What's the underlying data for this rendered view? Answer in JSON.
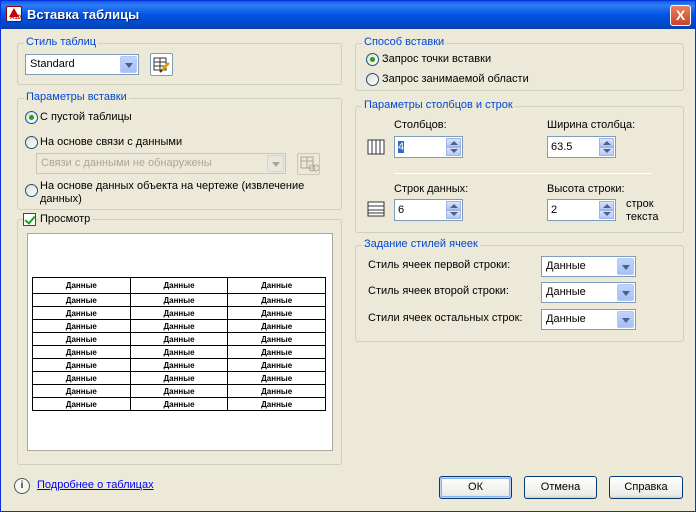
{
  "window": {
    "title": "Вставка таблицы",
    "close_label": "X",
    "app_icon_text": "A10"
  },
  "table_style": {
    "legend": "Стиль таблиц",
    "selected": "Standard",
    "edit_icon": "table-style-dialog-icon"
  },
  "insert_params": {
    "legend": "Параметры вставки",
    "options": [
      {
        "label": "С пустой таблицы",
        "checked": true
      },
      {
        "label": "На основе связи с данными",
        "checked": false
      },
      {
        "label": "На основе данных объекта на чертеже (извлечение данных)",
        "checked": false
      }
    ],
    "data_link_placeholder": "Связи с данными не обнаружены",
    "data_link_icon": "data-link-manager-icon"
  },
  "preview": {
    "label": "Просмотр",
    "checked": true,
    "header": [
      "Данные",
      "Данные",
      "Данные"
    ],
    "rows": [
      [
        "Данные",
        "Данные",
        "Данные"
      ],
      [
        "Данные",
        "Данные",
        "Данные"
      ],
      [
        "Данные",
        "Данные",
        "Данные"
      ],
      [
        "Данные",
        "Данные",
        "Данные"
      ],
      [
        "Данные",
        "Данные",
        "Данные"
      ],
      [
        "Данные",
        "Данные",
        "Данные"
      ],
      [
        "Данные",
        "Данные",
        "Данные"
      ],
      [
        "Данные",
        "Данные",
        "Данные"
      ],
      [
        "Данные",
        "Данные",
        "Данные"
      ]
    ]
  },
  "insert_method": {
    "legend": "Способ вставки",
    "options": [
      {
        "label": "Запрос точки вставки",
        "checked": true
      },
      {
        "label": "Запрос занимаемой области",
        "checked": false
      }
    ]
  },
  "columns_rows": {
    "legend": "Параметры столбцов и строк",
    "columns_label": "Столбцов:",
    "columns_value": "4",
    "col_width_label": "Ширина столбца:",
    "col_width_value": "63.5",
    "data_rows_label": "Строк данных:",
    "data_rows_value": "6",
    "row_height_label": "Высота строки:",
    "row_height_value": "2",
    "row_height_unit_1": "строк",
    "row_height_unit_2": "текста"
  },
  "cell_styles": {
    "legend": "Задание стилей ячеек",
    "first_row_label": "Стиль ячеек первой строки:",
    "first_row_value": "Данные",
    "second_row_label": "Стиль ячеек второй строки:",
    "second_row_value": "Данные",
    "other_rows_label": "Стили ячеек остальных строк:",
    "other_rows_value": "Данные"
  },
  "footer": {
    "help_link": "Подробнее о таблицах",
    "ok": "ОК",
    "cancel": "Отмена",
    "help": "Справка"
  },
  "colors": {
    "title_bar": "#0054e3",
    "legend_text": "#0046d5",
    "dialog_bg": "#ece9d8",
    "radio_dot": "#21a121"
  }
}
